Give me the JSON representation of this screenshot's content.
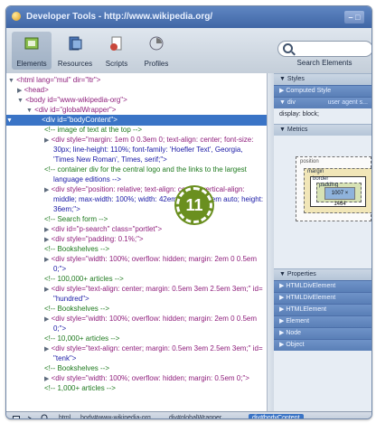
{
  "window": {
    "title": "Developer Tools - http://www.wikipedia.org/",
    "minimize_glyph": "– □"
  },
  "toolbar": {
    "tabs": [
      {
        "label": "Elements",
        "icon": "elements-icon"
      },
      {
        "label": "Resources",
        "icon": "resources-icon"
      },
      {
        "label": "Scripts",
        "icon": "scripts-icon"
      },
      {
        "label": "Profiles",
        "icon": "profiles-icon"
      }
    ],
    "search_label": "Search Elements"
  },
  "elements": {
    "rows": [
      {
        "t": "▼",
        "a": "<html lang=\"mul\" dir=\"ltr\">"
      },
      {
        "t": "▶",
        "a": "<head>"
      },
      {
        "t": "▼",
        "a": "<body id=\"www-wikipedia-org\">"
      },
      {
        "t": "▼",
        "a": "<div id=\"globalWrapper\">"
      },
      {
        "t": "▼",
        "a": "<div id=\"bodyContent\">"
      },
      {
        "t": "",
        "a": "<!-- image of text at the top -->"
      },
      {
        "t": "▶",
        "a": "<div style=\"margin: 1em 0 0.3em 0; text-align: center; font-size:"
      },
      {
        "t": "",
        "a": "30px; line-height: 110%; font-family: 'Hoefler Text', Georgia,"
      },
      {
        "t": "",
        "a": "'Times New Roman', Times, serif;\">"
      },
      {
        "t": "",
        "a": "<!-- container div for the central logo and the links to the largest"
      },
      {
        "t": "",
        "a": "language editions -->"
      },
      {
        "t": "▶",
        "a": "<div style=\"position: relative; text-align: center; vertical-align:"
      },
      {
        "t": "",
        "a": "middle; max-width: 100%; width: 42em; margin: 1em auto; height:"
      },
      {
        "t": "",
        "a": "36em;\">"
      },
      {
        "t": "",
        "a": "<!-- Search form -->"
      },
      {
        "t": "▶",
        "a": "<div id=\"p-search\" class=\"portlet\">"
      },
      {
        "t": "▶",
        "a": "<div style=\"padding: 0.1%;\">"
      },
      {
        "t": "",
        "a": "<!-- Bookshelves -->"
      },
      {
        "t": "▶",
        "a": "<div style=\"width: 100%; overflow: hidden; margin: 2em 0 0.5em"
      },
      {
        "t": "",
        "a": "0;\">"
      },
      {
        "t": "",
        "a": "<!-- 100,000+ articles -->"
      },
      {
        "t": "▶",
        "a": "<div style=\"text-align: center; margin: 0.5em 3em 2.5em 3em;\" id="
      },
      {
        "t": "",
        "a": "\"hundred\">"
      },
      {
        "t": "",
        "a": "<!-- Bookshelves -->"
      },
      {
        "t": "▶",
        "a": "<div style=\"width: 100%; overflow: hidden; margin: 2em 0 0.5em"
      },
      {
        "t": "",
        "a": "0;\">"
      },
      {
        "t": "",
        "a": "<!-- 10,000+ articles -->"
      },
      {
        "t": "▶",
        "a": "<div style=\"text-align: center; margin: 0.5em 3em 2.5em 3em;\" id="
      },
      {
        "t": "",
        "a": "\"tenk\">"
      },
      {
        "t": "",
        "a": "<!-- Bookshelves -->"
      },
      {
        "t": "▶",
        "a": "<div style=\"width: 100%; overflow: hidden; margin: 0.5em 0;\">"
      },
      {
        "t": "",
        "a": "<!-- 1,000+ articles -->"
      }
    ],
    "selected_index": 4
  },
  "sidebar": {
    "styles_title": "▼ Styles",
    "computed_style": "▶ Computed Style",
    "div_rule": "▼ div",
    "div_rule_source": "user agent s...",
    "display_prop": "display: block;",
    "metrics_title": "▼ Metrics",
    "metrics": {
      "position": "position",
      "margin": "margin",
      "border": "border",
      "padding": "padding",
      "content": "1007 × 1464",
      "dash": "–"
    },
    "properties_title": "▼ Properties",
    "properties": [
      "▶ HTMLDivElement",
      "▶ HTMLDivElement",
      "▶ HTMLElement",
      "▶ Element",
      "▶ Node",
      "▶ Object"
    ]
  },
  "statusbar": {
    "crumbs": [
      "html",
      "body#www-wikipedia-org",
      "div#globalWrapper",
      "div#bodyContent"
    ],
    "selected_crumb": 3
  },
  "callout": "11"
}
